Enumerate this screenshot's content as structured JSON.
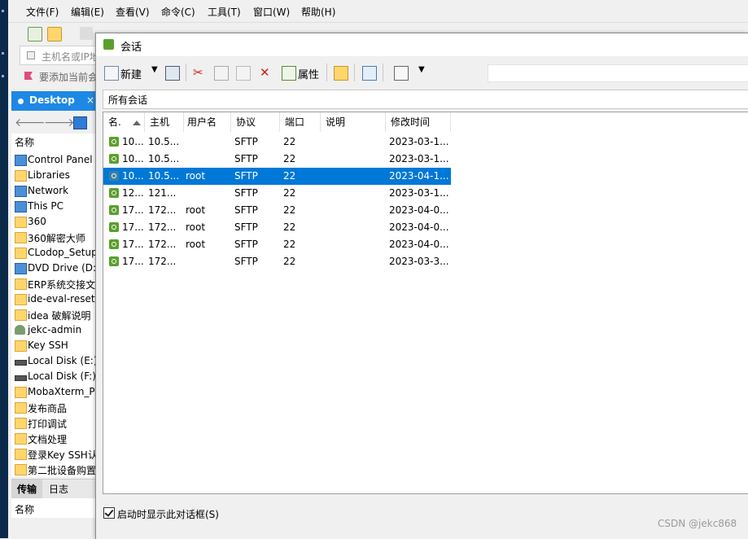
{
  "menubar": {
    "items": [
      "文件(F)",
      "编辑(E)",
      "查看(V)",
      "命令(C)",
      "工具(T)",
      "窗口(W)",
      "帮助(H)"
    ]
  },
  "address_bar": {
    "placeholder": "主机名或IP地"
  },
  "bookmark_bar": {
    "text": "要添加当前会"
  },
  "desktop_tab": {
    "label": "Desktop",
    "close": "×"
  },
  "file_panel": {
    "header": "名称",
    "items": [
      {
        "name": "Control Panel",
        "icon": "control-panel-icon"
      },
      {
        "name": "Libraries",
        "icon": "libraries-icon"
      },
      {
        "name": "Network",
        "icon": "network-icon"
      },
      {
        "name": "This PC",
        "icon": "pc-icon"
      },
      {
        "name": "360",
        "icon": "folder-icon"
      },
      {
        "name": "360解密大师",
        "icon": "folder-icon"
      },
      {
        "name": "CLodop_Setup_f",
        "icon": "folder-icon"
      },
      {
        "name": "DVD Drive (D:) S",
        "icon": "dvd-drive-icon"
      },
      {
        "name": "ERP系统交接文",
        "icon": "folder-icon"
      },
      {
        "name": "ide-eval-resette",
        "icon": "folder-icon"
      },
      {
        "name": "idea 破解说明",
        "icon": "folder-icon"
      },
      {
        "name": "jekc-admin",
        "icon": "user-icon"
      },
      {
        "name": "Key SSH",
        "icon": "folder-icon"
      },
      {
        "name": "Local Disk (E:)",
        "icon": "drive-icon"
      },
      {
        "name": "Local Disk (F:)",
        "icon": "drive-icon"
      },
      {
        "name": "MobaXterm_Po",
        "icon": "folder-icon"
      },
      {
        "name": "发布商品",
        "icon": "folder-icon"
      },
      {
        "name": "打印调试",
        "icon": "folder-icon"
      },
      {
        "name": "文档处理",
        "icon": "folder-icon"
      },
      {
        "name": "登录Key SSH认",
        "icon": "folder-icon"
      },
      {
        "name": "第二批设备购置",
        "icon": "folder-icon"
      }
    ]
  },
  "bottom_tabs": {
    "transfer": "传输",
    "log": "日志",
    "header": "名称"
  },
  "dialog": {
    "title": "会话",
    "toolbar": {
      "new": "新建",
      "properties": "属性"
    },
    "scope": "所有会话",
    "columns": [
      "名.",
      "主机",
      "用户名",
      "协议",
      "端口",
      "说明",
      "修改时间"
    ],
    "rows": [
      {
        "name": "10...",
        "host": "10.5...",
        "user": "",
        "protocol": "SFTP",
        "port": "22",
        "desc": "",
        "modified": "2023-03-1...",
        "selected": false
      },
      {
        "name": "10...",
        "host": "10.5...",
        "user": "",
        "protocol": "SFTP",
        "port": "22",
        "desc": "",
        "modified": "2023-03-1...",
        "selected": false
      },
      {
        "name": "10...",
        "host": "10.5...",
        "user": "root",
        "protocol": "SFTP",
        "port": "22",
        "desc": "",
        "modified": "2023-04-1...",
        "selected": true
      },
      {
        "name": "12...",
        "host": "121...",
        "user": "",
        "protocol": "SFTP",
        "port": "22",
        "desc": "",
        "modified": "2023-03-1...",
        "selected": false
      },
      {
        "name": "17...",
        "host": "172...",
        "user": "root",
        "protocol": "SFTP",
        "port": "22",
        "desc": "",
        "modified": "2023-04-0...",
        "selected": false
      },
      {
        "name": "17...",
        "host": "172...",
        "user": "root",
        "protocol": "SFTP",
        "port": "22",
        "desc": "",
        "modified": "2023-04-0...",
        "selected": false
      },
      {
        "name": "17...",
        "host": "172...",
        "user": "root",
        "protocol": "SFTP",
        "port": "22",
        "desc": "",
        "modified": "2023-04-0...",
        "selected": false
      },
      {
        "name": "17...",
        "host": "172...",
        "user": "",
        "protocol": "SFTP",
        "port": "22",
        "desc": "",
        "modified": "2023-03-3...",
        "selected": false
      }
    ],
    "footer_checkbox": {
      "label": "启动时显示此对话框(S)",
      "checked": true
    }
  },
  "watermark": "CSDN @jekc868",
  "colors": {
    "selection": "#0078d7",
    "accent_tab": "#1e88e5",
    "session_icon": "#5aa02c"
  }
}
